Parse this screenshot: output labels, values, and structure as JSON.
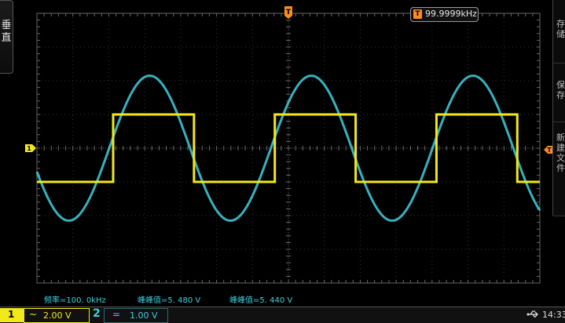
{
  "left_menu": {
    "label": "垂直"
  },
  "right_menu": {
    "items": [
      {
        "label": "存储"
      },
      {
        "label": "保存"
      },
      {
        "label": "新建文件"
      }
    ]
  },
  "trigger": {
    "marker_label": "T",
    "freq_icon": "T",
    "frequency": "99.9999kHz"
  },
  "markers": {
    "ch1_level": "1",
    "right_trigger": "T"
  },
  "measurements": {
    "freq": "频率=100. 0kHz",
    "vpp1": "峰峰值=5. 480  V",
    "vpp2": "峰峰值=5. 440  V"
  },
  "channels": [
    {
      "number": "1",
      "coupling": "~",
      "scale": "2.00 V",
      "color": "#f2e81a"
    },
    {
      "number": "2",
      "coupling": "=",
      "scale": "1.00 V",
      "color": "#3fd0e0"
    }
  ],
  "status": {
    "usb_icon": "usb-icon",
    "time": "14:33"
  },
  "waveforms": {
    "square": {
      "channel": 1,
      "color": "#f2e81a",
      "period_divs": 4.5,
      "amplitude_divs": 2.0
    },
    "sine": {
      "channel": 2,
      "color": "#3fd0e0",
      "period_divs": 4.5,
      "amplitude_divs": 4.3
    }
  }
}
